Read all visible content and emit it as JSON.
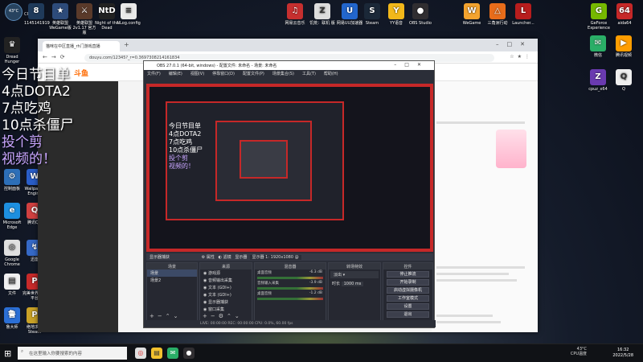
{
  "desktop_icons_left": [
    {
      "label": "1145141919",
      "char": "8",
      "color": "#1f3a5a"
    },
    {
      "label": "英雄联盟 WeGame版",
      "char": "★",
      "color": "#2d4b7a"
    },
    {
      "label": "英雄联盟2v1.17 官方版",
      "char": "⚔",
      "color": "#5a3a2a"
    },
    {
      "label": "Night of the Dead",
      "char": "NtD",
      "color": "#222"
    },
    {
      "label": "NLog.config",
      "char": "≡",
      "color": "#e9e9e9"
    }
  ],
  "desktop_icons_top_right": [
    {
      "label": "网易云音乐",
      "char": "♫",
      "color": "#c62f2f"
    },
    {
      "label": "饥荒：联机 版",
      "char": "Z",
      "color": "#ddd"
    },
    {
      "label": "网易UU加速器",
      "char": "U",
      "color": "#2266cc"
    },
    {
      "label": "Steam",
      "char": "S",
      "color": "#1b2838"
    },
    {
      "label": "YY语音",
      "char": "Y",
      "color": "#f2b81a"
    },
    {
      "label": "OBS Studio",
      "char": "●",
      "color": "#302e31"
    },
    {
      "label": "WeGame",
      "char": "W",
      "color": "#f3a32e"
    },
    {
      "label": "三角洲行动",
      "char": "△",
      "color": "#e86c1a"
    },
    {
      "label": "Launcher...",
      "char": "L",
      "color": "#b81d1d"
    },
    {
      "label": "GeForce Experience",
      "char": "G",
      "color": "#76b900"
    },
    {
      "label": "aida64",
      "char": "64",
      "color": "#c62828"
    }
  ],
  "desktop_icons_right_col": [
    {
      "label": "微信",
      "char": "✉",
      "color": "#2aae67"
    },
    {
      "label": "腾讯视频",
      "char": "▶",
      "color": "#ff9d00"
    },
    {
      "label": "cpuz_x64",
      "char": "Z",
      "color": "#6a3ab0"
    },
    {
      "label": "Q",
      "char": "Q",
      "color": "#eee"
    }
  ],
  "desktop_icons_side": [
    {
      "label": "Dread Hunger",
      "char": "♛",
      "color": "#222"
    },
    {
      "label": "控制面板",
      "char": "⚙",
      "color": "#2d6fb8"
    },
    {
      "label": "Wallpaper Engine",
      "char": "W",
      "color": "#2a5ec9"
    },
    {
      "label": "Microsoft Edge",
      "char": "e",
      "color": "#1d8fe0"
    },
    {
      "label": "腾讯QQ",
      "char": "Q",
      "color": "#d04040"
    },
    {
      "label": "Google Chrome",
      "char": "◎",
      "color": "#e0e0e0"
    },
    {
      "label": "迅雷",
      "char": "↯",
      "color": "#3569c7"
    },
    {
      "label": "文件",
      "char": "▤",
      "color": "#f0f0f0"
    },
    {
      "label": "完美世界竞技平台",
      "char": "P",
      "color": "#c72a2a"
    },
    {
      "label": "鲁大师",
      "char": "鲁",
      "color": "#2b6fd6"
    },
    {
      "label": "绝地求生 Steam",
      "char": "P",
      "color": "#c9a227"
    }
  ],
  "overlay": {
    "line1": "今日节目单",
    "line2": "4点DOTA2",
    "line3": "7点吃鸡",
    "line4": "10点杀僵尸",
    "line5": "投个剪",
    "line6": "视频的！"
  },
  "browser": {
    "tab_title": "猫咪在中区直播_rh门游戏直播",
    "url": "douyu.com/12345?_r=0.3697308214161834",
    "site_logo": "斗鱼"
  },
  "obs": {
    "title": "OBS 27.0.1 (64-bit, windows) - 配置文件: 未命名 - 场景: 未命名",
    "menu": [
      "文件(F)",
      "编辑(E)",
      "视图(V)",
      "停靠窗口(D)",
      "配置文件(P)",
      "场景集合(S)",
      "工具(T)",
      "帮助(H)"
    ],
    "no_source_label": "显示器捕获",
    "status_props": "属性",
    "status_filters": "滤镜",
    "status_display_label": "显示器",
    "status_display_value": "显示器 1: 1920x1080 @",
    "docks": {
      "scenes": {
        "title": "场景",
        "items": [
          "场景",
          "场景2"
        ]
      },
      "sources": {
        "title": "来源",
        "items": [
          "游戏源",
          "音频输出采集",
          "文本 (GDI+)",
          "文本 (GDI+)",
          "显示器捕获",
          "窗口采集"
        ]
      },
      "mixer": {
        "title": "混音器",
        "channels": [
          {
            "name": "桌面音频",
            "db": "-6.3 dB"
          },
          {
            "name": "音频输入采集",
            "db": "-3.9 dB"
          },
          {
            "name": "桌面音频",
            "db": "-1.2 dB"
          }
        ]
      },
      "transitions": {
        "title": "转场特效",
        "type": "淡出",
        "duration_label": "时长",
        "duration": "1000 ms"
      },
      "controls": {
        "title": "控件",
        "buttons": [
          "停止推流",
          "开始录制",
          "启动虚拟摄像机",
          "工作室模式",
          "设置",
          "退出"
        ]
      }
    },
    "status": "LIVE: 00:00:00   REC: 00:00:00   CPU: 0.0%, 60.00 fps"
  },
  "taskbar": {
    "search_placeholder": "在这里输入你要搜索的内容",
    "tray_temp": "43°C",
    "tray_label": "CPU温度",
    "time": "16:32",
    "date": "2022/5/28"
  },
  "desktop_widget": {
    "temp": "43°C",
    "label": "CPU温度"
  }
}
